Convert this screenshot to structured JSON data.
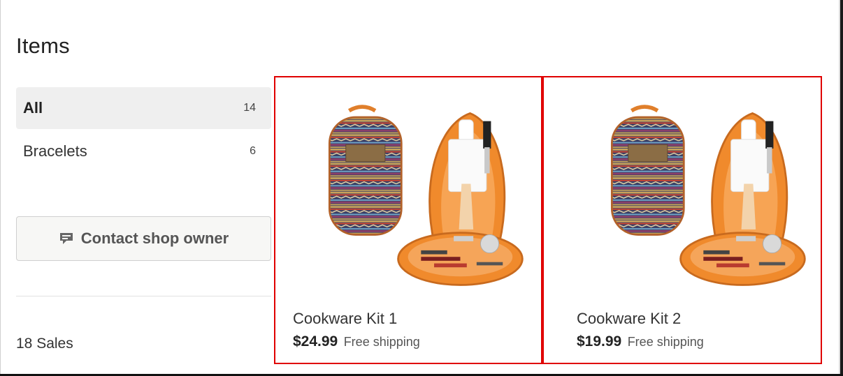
{
  "section": {
    "title": "Items"
  },
  "categories": [
    {
      "name": "All",
      "count": "14",
      "active": true
    },
    {
      "name": "Bracelets",
      "count": "6",
      "active": false
    }
  ],
  "contact": {
    "label": "Contact shop owner",
    "icon": "message-icon"
  },
  "sales": {
    "text": "18 Sales"
  },
  "products": [
    {
      "title": "Cookware Kit 1",
      "price": "$24.99",
      "shipping": "Free shipping"
    },
    {
      "title": "Cookware Kit 2",
      "price": "$19.99",
      "shipping": "Free shipping"
    }
  ],
  "colors": {
    "highlight_border": "#e00000",
    "active_category_bg": "#efefef",
    "product_orange": "#f08a2c"
  }
}
